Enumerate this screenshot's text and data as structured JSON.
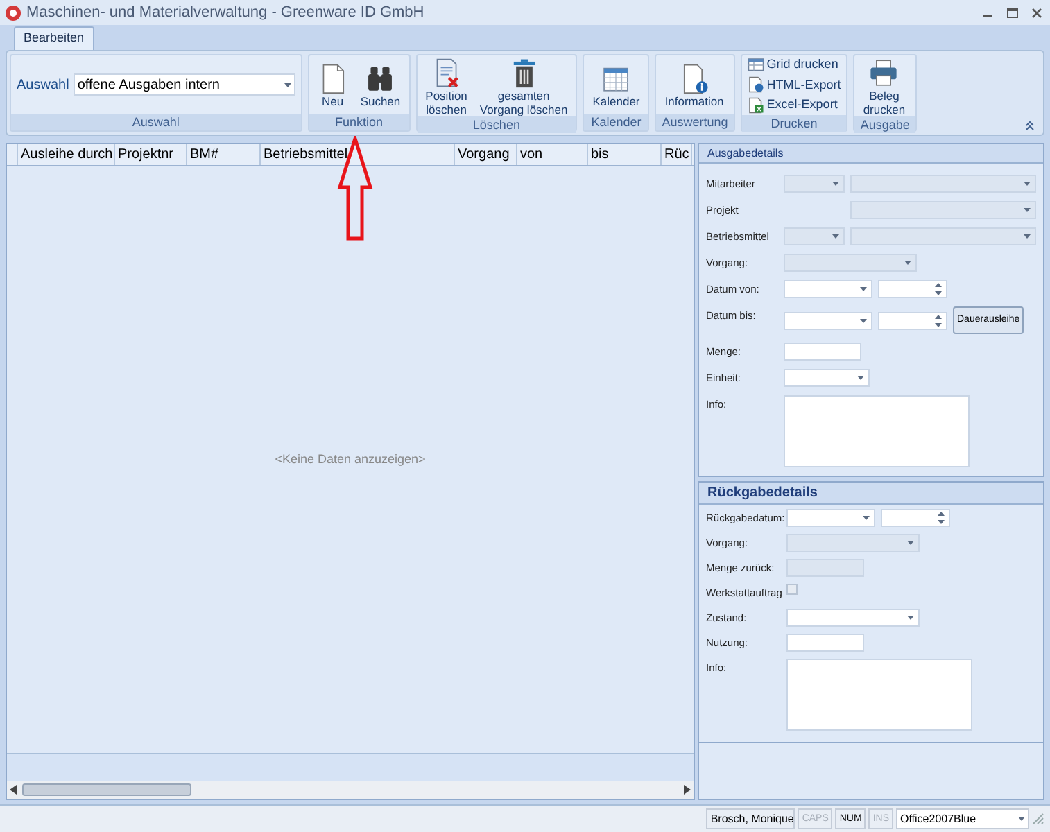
{
  "window": {
    "title": "Maschinen- und Materialverwaltung - Greenware ID GmbH"
  },
  "tabs": [
    {
      "label": "Bearbeiten",
      "selected": true
    }
  ],
  "ribbon": {
    "groups": [
      {
        "label": "Auswahl",
        "kind": "selector",
        "field_label": "Auswahl",
        "value": "offene Ausgaben intern"
      },
      {
        "label": "Funktion",
        "kind": "buttons",
        "buttons": [
          {
            "label": "Neu",
            "kind": "large"
          },
          {
            "label": "Suchen",
            "kind": "large"
          }
        ]
      },
      {
        "label": "Löschen",
        "kind": "buttons",
        "buttons": [
          {
            "label": "Position\nlöschen",
            "kind": "large"
          },
          {
            "label": "gesamten\nVorgang löschen",
            "kind": "large"
          }
        ]
      },
      {
        "label": "Kalender",
        "kind": "buttons",
        "buttons": [
          {
            "label": "Kalender",
            "kind": "large"
          }
        ]
      },
      {
        "label": "Auswertung",
        "kind": "buttons",
        "buttons": [
          {
            "label": "Information",
            "kind": "large"
          }
        ]
      },
      {
        "label": "Drucken",
        "kind": "buttons",
        "buttons": [
          {
            "label": "Grid drucken",
            "kind": "small"
          },
          {
            "label": "HTML-Export",
            "kind": "small"
          },
          {
            "label": "Excel-Export",
            "kind": "small"
          }
        ]
      },
      {
        "label": "Ausgabe",
        "kind": "buttons",
        "buttons": [
          {
            "label": "Beleg\ndrucken",
            "kind": "large"
          }
        ]
      }
    ]
  },
  "grid": {
    "columns": [
      "Ausleihe durch",
      "Projektnr",
      "BM#",
      "Betriebsmittel",
      "Vorgang",
      "von",
      "bis",
      "Rüc"
    ],
    "empty_text": "<Keine Daten anzuzeigen>"
  },
  "issue_details": {
    "title": "Ausgabedetails",
    "rows": [
      {
        "label": "Mitarbeiter",
        "controls": [
          {
            "kind": "short_combo",
            "disabled": true
          },
          {
            "kind": "long_combo",
            "disabled": true
          }
        ]
      },
      {
        "label": "Projekt",
        "controls": [
          {
            "kind": "gap"
          },
          {
            "kind": "long_combo",
            "disabled": true
          }
        ]
      },
      {
        "label": "Betriebsmittel",
        "controls": [
          {
            "kind": "short_combo",
            "disabled": true
          },
          {
            "kind": "long_combo",
            "disabled": true
          }
        ]
      },
      {
        "label": "Vorgang:",
        "controls": [
          {
            "kind": "combo",
            "disabled": true
          }
        ]
      },
      {
        "label": "Datum von:",
        "controls": [
          {
            "kind": "date",
            "disabled": false
          },
          {
            "kind": "time",
            "disabled": false
          }
        ]
      },
      {
        "label": "Datum bis:",
        "controls": [
          {
            "kind": "date",
            "disabled": false
          },
          {
            "kind": "time",
            "disabled": false
          },
          {
            "kind": "button",
            "label": "Dauerausleihe"
          }
        ]
      },
      {
        "label": "Menge:",
        "controls": [
          {
            "kind": "text",
            "disabled": false
          }
        ]
      },
      {
        "label": "Einheit:",
        "controls": [
          {
            "kind": "unit_combo",
            "disabled": false
          }
        ]
      },
      {
        "label": "Info:",
        "controls": [
          {
            "kind": "memo",
            "disabled": false
          }
        ]
      }
    ]
  },
  "return_details": {
    "title": "Rückgabedetails",
    "rows": [
      {
        "label": "Rückgabedatum:",
        "controls": [
          {
            "kind": "date",
            "disabled": false
          },
          {
            "kind": "time",
            "disabled": false
          }
        ]
      },
      {
        "label": "Vorgang:",
        "controls": [
          {
            "kind": "combo",
            "disabled": true
          }
        ]
      },
      {
        "label": "Menge zurück:",
        "controls": [
          {
            "kind": "text",
            "disabled": true
          }
        ]
      },
      {
        "label": "Werkstattauftrag",
        "controls": [
          {
            "kind": "checkbox",
            "disabled": true,
            "checked": false
          }
        ]
      },
      {
        "label": "Zustand:",
        "controls": [
          {
            "kind": "combo",
            "disabled": false
          }
        ]
      },
      {
        "label": "Nutzung:",
        "controls": [
          {
            "kind": "text",
            "disabled": false
          }
        ]
      },
      {
        "label": "Info:",
        "controls": [
          {
            "kind": "memo",
            "disabled": false
          }
        ]
      }
    ]
  },
  "status_bar": {
    "user": "Brosch, Monique",
    "indicators": [
      {
        "label": "CAPS",
        "on": false
      },
      {
        "label": "NUM",
        "on": true
      },
      {
        "label": "INS",
        "on": false
      }
    ],
    "theme": "Office2007Blue"
  }
}
